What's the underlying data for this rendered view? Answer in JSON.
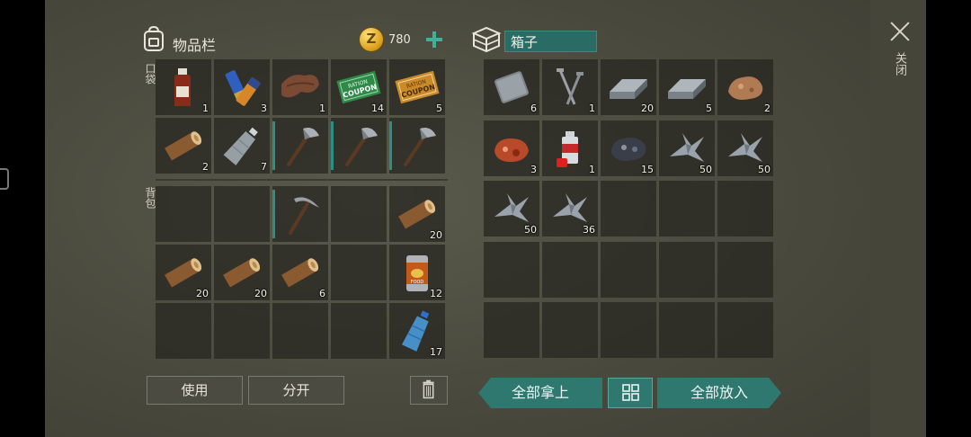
{
  "inventory": {
    "title": "物品栏",
    "coins": "780",
    "coin_symbol": "Z",
    "pockets_label": "口袋",
    "backpack_label": "背包",
    "pockets": [
      {
        "icon": "alcohol-bottle-icon",
        "qty": "1"
      },
      {
        "icon": "batteries-icon",
        "qty": "3"
      },
      {
        "icon": "leather-icon",
        "qty": "1"
      },
      {
        "icon": "green-coupon-icon",
        "qty": "14",
        "coupon_top": "RATION",
        "coupon_main": "COUPON"
      },
      {
        "icon": "orange-coupon-icon",
        "qty": "5",
        "coupon_top": "RATION",
        "coupon_main": "COUPON"
      },
      {
        "icon": "log-icon",
        "qty": "2"
      },
      {
        "icon": "empty-water-bottle-icon",
        "qty": "7"
      },
      {
        "icon": "hatchet-icon",
        "qty": "",
        "durability": true
      },
      {
        "icon": "hatchet-icon",
        "qty": "",
        "durability": true
      },
      {
        "icon": "hatchet-icon",
        "qty": "",
        "durability": true
      }
    ],
    "backpack": [
      {
        "icon": "",
        "qty": ""
      },
      {
        "icon": "",
        "qty": ""
      },
      {
        "icon": "pickaxe-icon",
        "qty": "",
        "durability": true
      },
      {
        "icon": "",
        "qty": ""
      },
      {
        "icon": "log-icon",
        "qty": "20"
      },
      {
        "icon": "log-icon",
        "qty": "20"
      },
      {
        "icon": "log-icon",
        "qty": "20"
      },
      {
        "icon": "log-icon",
        "qty": "6"
      },
      {
        "icon": "",
        "qty": ""
      },
      {
        "icon": "canned-food-icon",
        "qty": "12",
        "can_label": "FOOD"
      },
      {
        "icon": "",
        "qty": ""
      },
      {
        "icon": "",
        "qty": ""
      },
      {
        "icon": "",
        "qty": ""
      },
      {
        "icon": "",
        "qty": ""
      },
      {
        "icon": "water-bottle-icon",
        "qty": "17"
      }
    ],
    "use_label": "使用",
    "split_label": "分开"
  },
  "box": {
    "name": "箱子",
    "slots": [
      {
        "icon": "metal-plate-icon",
        "qty": "6"
      },
      {
        "icon": "nails-icon",
        "qty": "1"
      },
      {
        "icon": "iron-bar-icon",
        "qty": "20"
      },
      {
        "icon": "iron-bar-icon",
        "qty": "5"
      },
      {
        "icon": "copper-ore-icon",
        "qty": "2"
      },
      {
        "icon": "raw-meat-icon",
        "qty": "3"
      },
      {
        "icon": "spray-paint-icon",
        "qty": "1"
      },
      {
        "icon": "iron-ore-icon",
        "qty": "15"
      },
      {
        "icon": "metal-scrap-icon",
        "qty": "50"
      },
      {
        "icon": "metal-scrap-icon",
        "qty": "50"
      },
      {
        "icon": "metal-scrap-icon",
        "qty": "50"
      },
      {
        "icon": "metal-scrap-icon",
        "qty": "36"
      },
      {
        "icon": "",
        "qty": ""
      },
      {
        "icon": "",
        "qty": ""
      },
      {
        "icon": "",
        "qty": ""
      },
      {
        "icon": "",
        "qty": ""
      },
      {
        "icon": "",
        "qty": ""
      },
      {
        "icon": "",
        "qty": ""
      },
      {
        "icon": "",
        "qty": ""
      },
      {
        "icon": "",
        "qty": ""
      },
      {
        "icon": "",
        "qty": ""
      },
      {
        "icon": "",
        "qty": ""
      },
      {
        "icon": "",
        "qty": ""
      },
      {
        "icon": "",
        "qty": ""
      },
      {
        "icon": "",
        "qty": ""
      }
    ],
    "take_all_label": "全部拿上",
    "put_all_label": "全部放入"
  },
  "close_label": "关闭",
  "colors": {
    "accent": "#2f7870",
    "plus": "#3fb09a",
    "durability": "#2a8f86"
  }
}
